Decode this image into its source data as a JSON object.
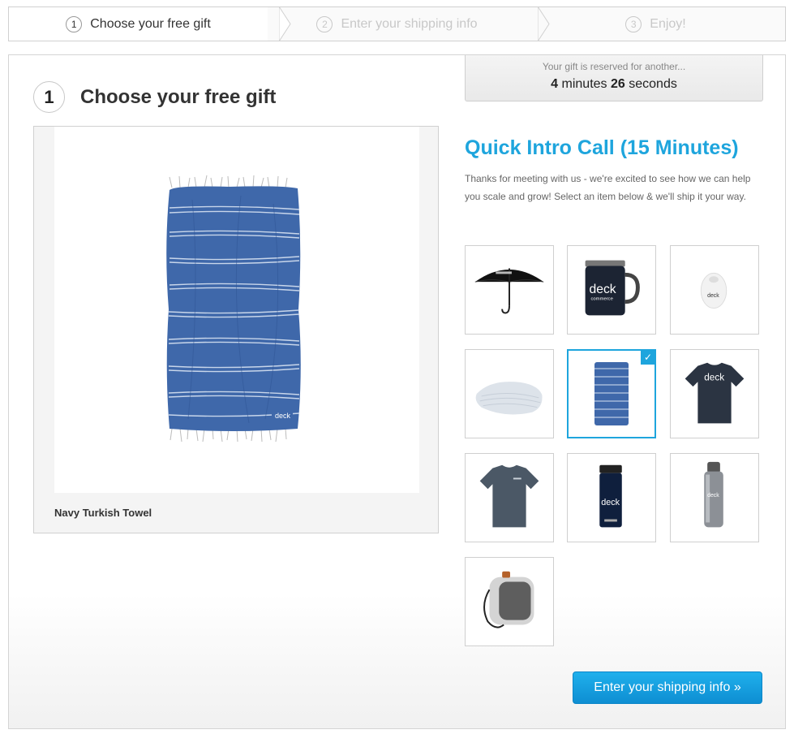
{
  "stepper": {
    "steps": [
      {
        "num": "1",
        "label": "Choose your free gift",
        "state": "active"
      },
      {
        "num": "2",
        "label": "Enter your shipping info",
        "state": "inactive"
      },
      {
        "num": "3",
        "label": "Enjoy!",
        "state": "inactive"
      }
    ]
  },
  "section": {
    "number": "1",
    "title": "Choose your free gift"
  },
  "preview": {
    "caption": "Navy Turkish Towel",
    "icon": "towel-image"
  },
  "timer": {
    "note": "Your gift is reserved for another...",
    "minutes": "4",
    "minutes_label": "minutes",
    "seconds": "26",
    "seconds_label": "seconds"
  },
  "offer": {
    "title": "Quick Intro Call (15 Minutes)",
    "description": "Thanks for meeting with us - we're excited to see how we can help you scale and grow! Select an item below & we'll ship it your way."
  },
  "gifts": [
    {
      "icon": "umbrella-icon",
      "selected": false
    },
    {
      "icon": "mug-icon",
      "selected": false
    },
    {
      "icon": "earbuds-case-icon",
      "selected": false
    },
    {
      "icon": "blanket-icon",
      "selected": false
    },
    {
      "icon": "towel-icon",
      "selected": true
    },
    {
      "icon": "dark-tshirt-icon",
      "selected": false
    },
    {
      "icon": "gray-tshirt-icon",
      "selected": false
    },
    {
      "icon": "tumbler-icon",
      "selected": false
    },
    {
      "icon": "water-bottle-icon",
      "selected": false
    },
    {
      "icon": "speaker-icon",
      "selected": false
    }
  ],
  "selected_check": "✓",
  "cta": {
    "label": "Enter your shipping info »"
  },
  "colors": {
    "accent": "#1ea5dd",
    "towel": "#3f68aa"
  }
}
